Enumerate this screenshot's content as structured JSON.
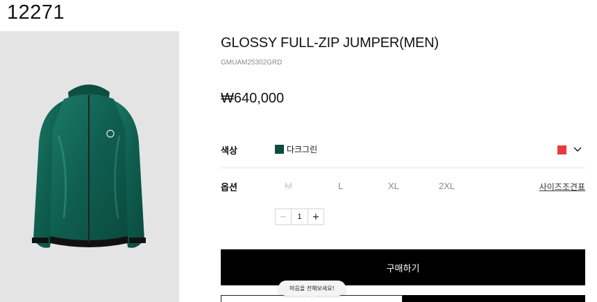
{
  "page_id": "12271",
  "product": {
    "title": "GLOSSY FULL-ZIP JUMPER(MEN)",
    "code": "GMUAM25302GRD",
    "price": "₩640,000",
    "image_icon": "green-zip-jacket"
  },
  "color": {
    "label": "색상",
    "selected_name": "다크그린",
    "selected_hex": "#0f4a3e",
    "alt_hex": "#e53a40",
    "dropdown_icon": "chevron-down-icon"
  },
  "option": {
    "label": "옵션",
    "sizes": [
      "M",
      "L",
      "XL",
      "2XL"
    ],
    "disabled_size": "M",
    "size_guide": "사이즈조견표"
  },
  "quantity": {
    "minus": "−",
    "value": "1",
    "plus": "+"
  },
  "actions": {
    "buy_label": "구매하기"
  },
  "tooltip": {
    "text": "마음을 전해보세요!"
  }
}
